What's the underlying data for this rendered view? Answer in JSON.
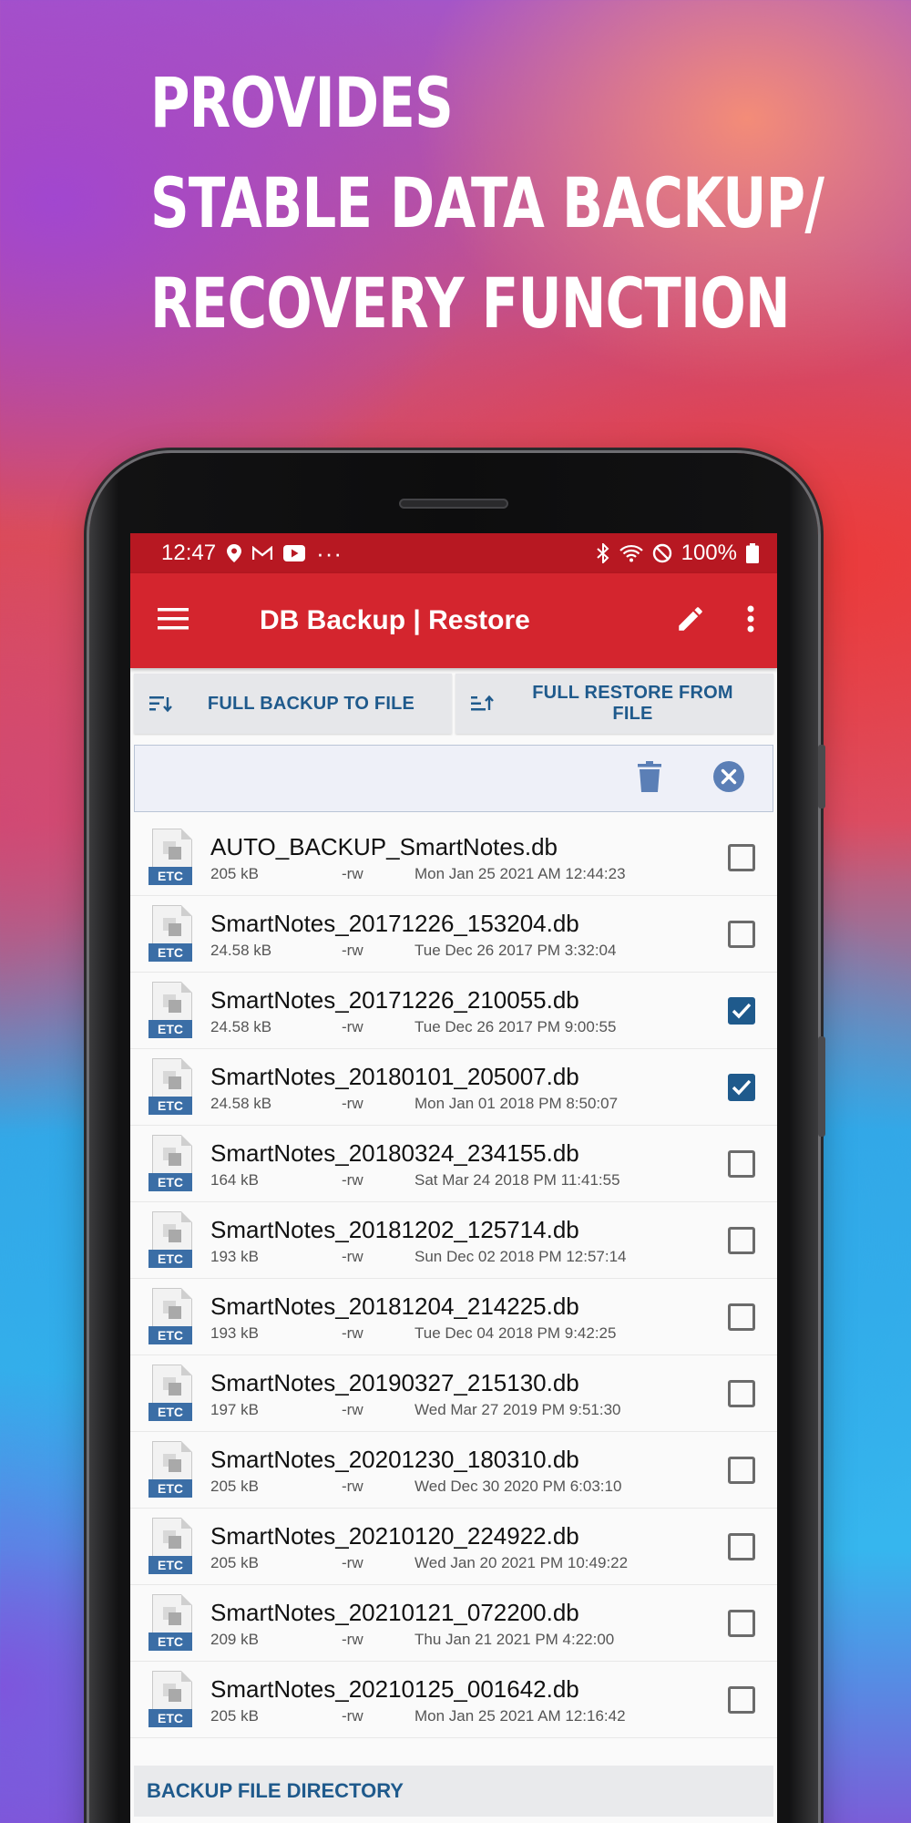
{
  "headline": [
    "PROVIDES",
    "STABLE DATA BACKUP/",
    "RECOVERY FUNCTION"
  ],
  "status_bar": {
    "time": "12:47",
    "dots": "···",
    "battery": "100%"
  },
  "app_bar": {
    "title": "DB Backup | Restore"
  },
  "actions": {
    "backup_label": "FULL BACKUP TO FILE",
    "restore_label": "FULL RESTORE FROM FILE"
  },
  "files": [
    {
      "name": "AUTO_BACKUP_SmartNotes.db",
      "size": "205 kB",
      "perm": "-rw",
      "date": "Mon Jan 25 2021 AM 12:44:23",
      "checked": false,
      "type": "ETC"
    },
    {
      "name": "SmartNotes_20171226_153204.db",
      "size": "24.58 kB",
      "perm": "-rw",
      "date": "Tue Dec 26 2017 PM 3:32:04",
      "checked": false,
      "type": "ETC"
    },
    {
      "name": "SmartNotes_20171226_210055.db",
      "size": "24.58 kB",
      "perm": "-rw",
      "date": "Tue Dec 26 2017 PM 9:00:55",
      "checked": true,
      "type": "ETC"
    },
    {
      "name": "SmartNotes_20180101_205007.db",
      "size": "24.58 kB",
      "perm": "-rw",
      "date": "Mon Jan 01 2018 PM 8:50:07",
      "checked": true,
      "type": "ETC"
    },
    {
      "name": "SmartNotes_20180324_234155.db",
      "size": "164 kB",
      "perm": "-rw",
      "date": "Sat Mar 24 2018 PM 11:41:55",
      "checked": false,
      "type": "ETC"
    },
    {
      "name": "SmartNotes_20181202_125714.db",
      "size": "193 kB",
      "perm": "-rw",
      "date": "Sun Dec 02 2018 PM 12:57:14",
      "checked": false,
      "type": "ETC"
    },
    {
      "name": "SmartNotes_20181204_214225.db",
      "size": "193 kB",
      "perm": "-rw",
      "date": "Tue Dec 04 2018 PM 9:42:25",
      "checked": false,
      "type": "ETC"
    },
    {
      "name": "SmartNotes_20190327_215130.db",
      "size": "197 kB",
      "perm": "-rw",
      "date": "Wed Mar 27 2019 PM 9:51:30",
      "checked": false,
      "type": "ETC"
    },
    {
      "name": "SmartNotes_20201230_180310.db",
      "size": "205 kB",
      "perm": "-rw",
      "date": "Wed Dec 30 2020 PM 6:03:10",
      "checked": false,
      "type": "ETC"
    },
    {
      "name": "SmartNotes_20210120_224922.db",
      "size": "205 kB",
      "perm": "-rw",
      "date": "Wed Jan 20 2021 PM 10:49:22",
      "checked": false,
      "type": "ETC"
    },
    {
      "name": "SmartNotes_20210121_072200.db",
      "size": "209 kB",
      "perm": "-rw",
      "date": "Thu Jan 21 2021 PM 4:22:00",
      "checked": false,
      "type": "ETC"
    },
    {
      "name": "SmartNotes_20210125_001642.db",
      "size": "205 kB",
      "perm": "-rw",
      "date": "Mon Jan 25 2021 AM 12:16:42",
      "checked": false,
      "type": "ETC"
    }
  ],
  "section_header": "BACKUP FILE DIRECTORY",
  "colors": {
    "status_bar": "#b71822",
    "app_bar": "#d4252e",
    "accent": "#1f5a8c",
    "etc_badge": "#3b6ea6"
  }
}
